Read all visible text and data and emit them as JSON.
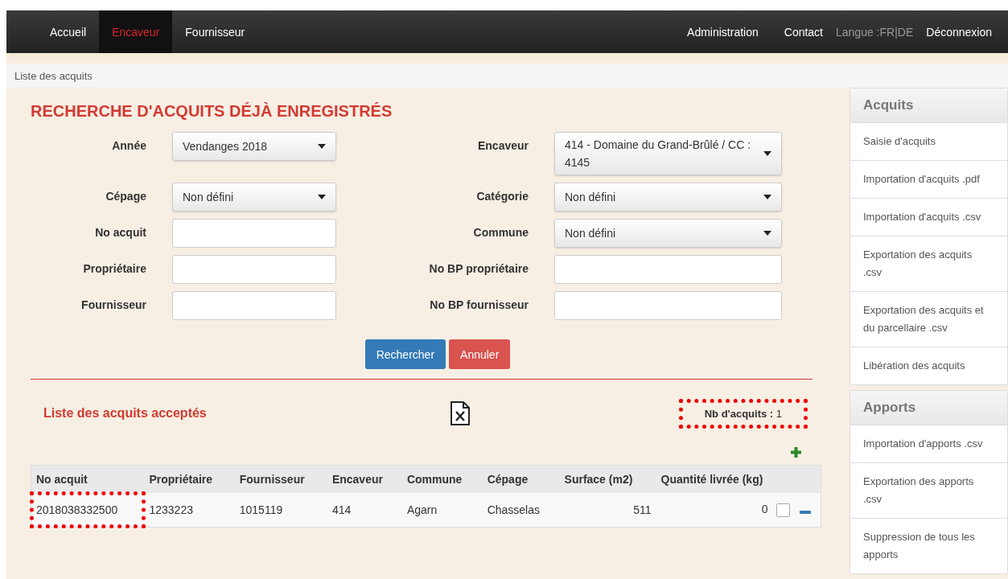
{
  "nav": {
    "left": [
      {
        "label": "Accueil",
        "selected": false
      },
      {
        "label": "Encaveur",
        "selected": true
      },
      {
        "label": "Fournisseur",
        "selected": false
      }
    ],
    "right": [
      {
        "label": "Administration",
        "muted": false
      },
      {
        "label": "Contact",
        "muted": false
      },
      {
        "label": "Langue :FR|DE",
        "muted": true
      },
      {
        "label": "Déconnexion",
        "muted": false
      }
    ]
  },
  "breadcrumb": "Liste des acquits",
  "search": {
    "title": "RECHERCHE D'ACQUITS DÉJÀ ENREGISTRÉS",
    "rows": [
      [
        {
          "label": "Année",
          "kind": "select",
          "value": "Vendanges 2018"
        },
        {
          "label": "Encaveur",
          "kind": "select",
          "value": "414 - Domaine du Grand-Brûlé / CC : 4145"
        }
      ],
      [
        {
          "label": "Cépage",
          "kind": "select",
          "value": "Non défini"
        },
        {
          "label": "Catégorie",
          "kind": "select",
          "value": "Non défini"
        }
      ],
      [
        {
          "label": "No acquit",
          "kind": "input"
        },
        {
          "label": "Commune",
          "kind": "select",
          "value": "Non défini"
        }
      ],
      [
        {
          "label": "Propriétaire",
          "kind": "input"
        },
        {
          "label": "No BP propriétaire",
          "kind": "input"
        }
      ],
      [
        {
          "label": "Fournisseur",
          "kind": "input"
        },
        {
          "label": "No BP fournisseur",
          "kind": "input"
        }
      ]
    ],
    "buttons": [
      {
        "label": "Rechercher",
        "kind": "primary"
      },
      {
        "label": "Annuler",
        "kind": "danger"
      }
    ]
  },
  "list": {
    "title": "Liste des acquits acceptés",
    "count": {
      "label": "Nb d'acquits :",
      "value": "1",
      "highlighted": true
    },
    "table": {
      "columns": [
        "No acquit",
        "Propriétaire",
        "Fournisseur",
        "Encaveur",
        "Commune",
        "Cépage",
        "Surface (m2)",
        "Quantité livrée (kg)"
      ],
      "rows": [
        {
          "cells": [
            "2018038332500",
            "1233223",
            "1015119",
            "414",
            "Agarn",
            "Chasselas",
            "511",
            "0"
          ],
          "highlighted": true,
          "checked": false
        }
      ]
    }
  },
  "sidebar": [
    {
      "title": "Acquits",
      "items": [
        "Saisie d'acquits",
        "Importation d'acquits .pdf",
        "Importation d'acquits .csv",
        "Exportation des acquits .csv",
        "Exportation des acquits et du parcellaire .csv",
        "Libération des acquits"
      ]
    },
    {
      "title": "Apports",
      "items": [
        "Importation d'apports .csv",
        "Exportation des apports .csv",
        "Suppression de tous les apports"
      ]
    }
  ]
}
